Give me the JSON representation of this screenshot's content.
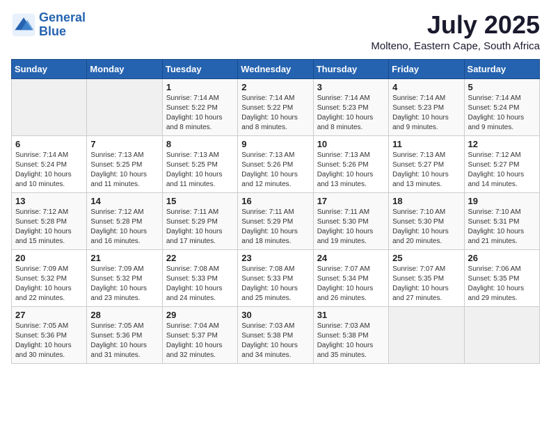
{
  "logo": {
    "line1": "General",
    "line2": "Blue"
  },
  "title": "July 2025",
  "location": "Molteno, Eastern Cape, South Africa",
  "weekdays": [
    "Sunday",
    "Monday",
    "Tuesday",
    "Wednesday",
    "Thursday",
    "Friday",
    "Saturday"
  ],
  "weeks": [
    [
      {
        "day": "",
        "sunrise": "",
        "sunset": "",
        "daylight": ""
      },
      {
        "day": "",
        "sunrise": "",
        "sunset": "",
        "daylight": ""
      },
      {
        "day": "1",
        "sunrise": "Sunrise: 7:14 AM",
        "sunset": "Sunset: 5:22 PM",
        "daylight": "Daylight: 10 hours and 8 minutes."
      },
      {
        "day": "2",
        "sunrise": "Sunrise: 7:14 AM",
        "sunset": "Sunset: 5:22 PM",
        "daylight": "Daylight: 10 hours and 8 minutes."
      },
      {
        "day": "3",
        "sunrise": "Sunrise: 7:14 AM",
        "sunset": "Sunset: 5:23 PM",
        "daylight": "Daylight: 10 hours and 8 minutes."
      },
      {
        "day": "4",
        "sunrise": "Sunrise: 7:14 AM",
        "sunset": "Sunset: 5:23 PM",
        "daylight": "Daylight: 10 hours and 9 minutes."
      },
      {
        "day": "5",
        "sunrise": "Sunrise: 7:14 AM",
        "sunset": "Sunset: 5:24 PM",
        "daylight": "Daylight: 10 hours and 9 minutes."
      }
    ],
    [
      {
        "day": "6",
        "sunrise": "Sunrise: 7:14 AM",
        "sunset": "Sunset: 5:24 PM",
        "daylight": "Daylight: 10 hours and 10 minutes."
      },
      {
        "day": "7",
        "sunrise": "Sunrise: 7:13 AM",
        "sunset": "Sunset: 5:25 PM",
        "daylight": "Daylight: 10 hours and 11 minutes."
      },
      {
        "day": "8",
        "sunrise": "Sunrise: 7:13 AM",
        "sunset": "Sunset: 5:25 PM",
        "daylight": "Daylight: 10 hours and 11 minutes."
      },
      {
        "day": "9",
        "sunrise": "Sunrise: 7:13 AM",
        "sunset": "Sunset: 5:26 PM",
        "daylight": "Daylight: 10 hours and 12 minutes."
      },
      {
        "day": "10",
        "sunrise": "Sunrise: 7:13 AM",
        "sunset": "Sunset: 5:26 PM",
        "daylight": "Daylight: 10 hours and 13 minutes."
      },
      {
        "day": "11",
        "sunrise": "Sunrise: 7:13 AM",
        "sunset": "Sunset: 5:27 PM",
        "daylight": "Daylight: 10 hours and 13 minutes."
      },
      {
        "day": "12",
        "sunrise": "Sunrise: 7:12 AM",
        "sunset": "Sunset: 5:27 PM",
        "daylight": "Daylight: 10 hours and 14 minutes."
      }
    ],
    [
      {
        "day": "13",
        "sunrise": "Sunrise: 7:12 AM",
        "sunset": "Sunset: 5:28 PM",
        "daylight": "Daylight: 10 hours and 15 minutes."
      },
      {
        "day": "14",
        "sunrise": "Sunrise: 7:12 AM",
        "sunset": "Sunset: 5:28 PM",
        "daylight": "Daylight: 10 hours and 16 minutes."
      },
      {
        "day": "15",
        "sunrise": "Sunrise: 7:11 AM",
        "sunset": "Sunset: 5:29 PM",
        "daylight": "Daylight: 10 hours and 17 minutes."
      },
      {
        "day": "16",
        "sunrise": "Sunrise: 7:11 AM",
        "sunset": "Sunset: 5:29 PM",
        "daylight": "Daylight: 10 hours and 18 minutes."
      },
      {
        "day": "17",
        "sunrise": "Sunrise: 7:11 AM",
        "sunset": "Sunset: 5:30 PM",
        "daylight": "Daylight: 10 hours and 19 minutes."
      },
      {
        "day": "18",
        "sunrise": "Sunrise: 7:10 AM",
        "sunset": "Sunset: 5:30 PM",
        "daylight": "Daylight: 10 hours and 20 minutes."
      },
      {
        "day": "19",
        "sunrise": "Sunrise: 7:10 AM",
        "sunset": "Sunset: 5:31 PM",
        "daylight": "Daylight: 10 hours and 21 minutes."
      }
    ],
    [
      {
        "day": "20",
        "sunrise": "Sunrise: 7:09 AM",
        "sunset": "Sunset: 5:32 PM",
        "daylight": "Daylight: 10 hours and 22 minutes."
      },
      {
        "day": "21",
        "sunrise": "Sunrise: 7:09 AM",
        "sunset": "Sunset: 5:32 PM",
        "daylight": "Daylight: 10 hours and 23 minutes."
      },
      {
        "day": "22",
        "sunrise": "Sunrise: 7:08 AM",
        "sunset": "Sunset: 5:33 PM",
        "daylight": "Daylight: 10 hours and 24 minutes."
      },
      {
        "day": "23",
        "sunrise": "Sunrise: 7:08 AM",
        "sunset": "Sunset: 5:33 PM",
        "daylight": "Daylight: 10 hours and 25 minutes."
      },
      {
        "day": "24",
        "sunrise": "Sunrise: 7:07 AM",
        "sunset": "Sunset: 5:34 PM",
        "daylight": "Daylight: 10 hours and 26 minutes."
      },
      {
        "day": "25",
        "sunrise": "Sunrise: 7:07 AM",
        "sunset": "Sunset: 5:35 PM",
        "daylight": "Daylight: 10 hours and 27 minutes."
      },
      {
        "day": "26",
        "sunrise": "Sunrise: 7:06 AM",
        "sunset": "Sunset: 5:35 PM",
        "daylight": "Daylight: 10 hours and 29 minutes."
      }
    ],
    [
      {
        "day": "27",
        "sunrise": "Sunrise: 7:05 AM",
        "sunset": "Sunset: 5:36 PM",
        "daylight": "Daylight: 10 hours and 30 minutes."
      },
      {
        "day": "28",
        "sunrise": "Sunrise: 7:05 AM",
        "sunset": "Sunset: 5:36 PM",
        "daylight": "Daylight: 10 hours and 31 minutes."
      },
      {
        "day": "29",
        "sunrise": "Sunrise: 7:04 AM",
        "sunset": "Sunset: 5:37 PM",
        "daylight": "Daylight: 10 hours and 32 minutes."
      },
      {
        "day": "30",
        "sunrise": "Sunrise: 7:03 AM",
        "sunset": "Sunset: 5:38 PM",
        "daylight": "Daylight: 10 hours and 34 minutes."
      },
      {
        "day": "31",
        "sunrise": "Sunrise: 7:03 AM",
        "sunset": "Sunset: 5:38 PM",
        "daylight": "Daylight: 10 hours and 35 minutes."
      },
      {
        "day": "",
        "sunrise": "",
        "sunset": "",
        "daylight": ""
      },
      {
        "day": "",
        "sunrise": "",
        "sunset": "",
        "daylight": ""
      }
    ]
  ]
}
